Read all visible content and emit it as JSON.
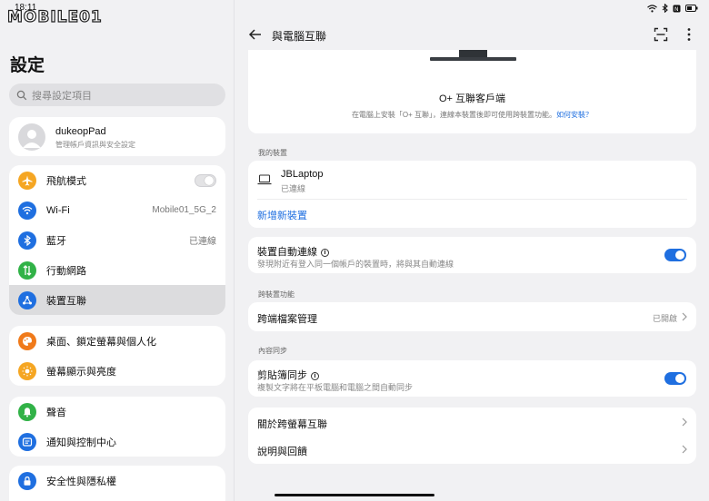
{
  "status": {
    "time": "18:11"
  },
  "watermark": {
    "text": "MOBILE01"
  },
  "left": {
    "title": "設定",
    "search_placeholder": "搜尋設定項目",
    "account": {
      "name": "dukeopPad",
      "subtitle": "管理帳戶資訊與安全設定"
    },
    "group1": [
      {
        "label": "飛航模式",
        "value": "",
        "icon": "airplane-icon",
        "color": "#f5a623",
        "toggle": "off"
      },
      {
        "label": "Wi-Fi",
        "value": "Mobile01_5G_2",
        "icon": "wifi-icon",
        "color": "#1f6fe0"
      },
      {
        "label": "藍牙",
        "value": "已連線",
        "icon": "bluetooth-icon",
        "color": "#1f6fe0"
      },
      {
        "label": "行動網路",
        "value": "",
        "icon": "mobile-network-icon",
        "color": "#31b247"
      },
      {
        "label": "裝置互聯",
        "value": "",
        "icon": "device-connect-icon",
        "color": "#1f6fe0",
        "active": true
      }
    ],
    "group2": [
      {
        "label": "桌面、鎖定螢幕與個人化",
        "icon": "palette-icon",
        "color": "#f07a1a"
      },
      {
        "label": "螢幕顯示與亮度",
        "icon": "brightness-icon",
        "color": "#f5a623"
      }
    ],
    "group3": [
      {
        "label": "聲音",
        "icon": "bell-icon",
        "color": "#31b247"
      },
      {
        "label": "通知與控制中心",
        "icon": "notification-icon",
        "color": "#1f6fe0"
      }
    ],
    "group4": [
      {
        "label": "安全性與隱私權",
        "icon": "lock-icon",
        "color": "#1f6fe0"
      }
    ]
  },
  "right": {
    "title": "與電腦互聯",
    "client": {
      "name": "O+ 互聯客戶端",
      "desc": "在電腦上安裝「O+ 互聯」，連線本裝置後即可使用跨裝置功能。",
      "link": "如何安裝？"
    },
    "my_devices_label": "我的裝置",
    "device": {
      "name": "JBLaptop",
      "status": "已連線"
    },
    "add_device": "新增新裝置",
    "auto_connect": {
      "title": "裝置自動連線",
      "desc": "發現附近有登入同一個帳戶的裝置時，將與其自動連線",
      "state": "on"
    },
    "cross_label": "跨裝置功能",
    "file_manage": {
      "title": "跨端檔案管理",
      "value": "已開啟"
    },
    "content_sync_label": "內容同步",
    "clipboard": {
      "title": "剪貼簿同步",
      "desc": "複製文字將在平板電腦和電腦之間自動同步",
      "state": "on"
    },
    "about": "關於跨螢幕互聯",
    "help": "說明與回饋"
  },
  "colors": {
    "accent": "#1f6fe0",
    "link": "#1f6fe0"
  }
}
